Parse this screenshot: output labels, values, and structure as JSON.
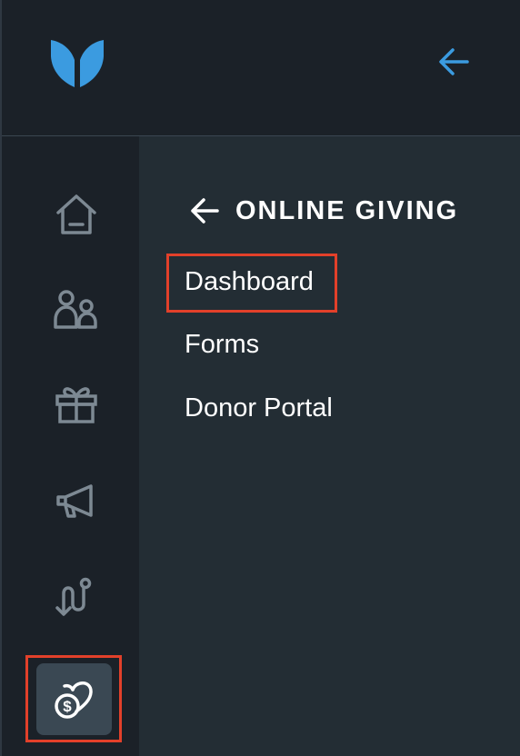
{
  "header": {
    "logo_icon": "shield-leaf-logo",
    "collapse_icon": "arrow-left-icon",
    "accent_color": "#3b9be0"
  },
  "rail": {
    "items": [
      {
        "icon": "home-icon"
      },
      {
        "icon": "people-icon"
      },
      {
        "icon": "gift-icon"
      },
      {
        "icon": "megaphone-icon"
      },
      {
        "icon": "route-icon"
      },
      {
        "icon": "donation-heart-icon",
        "active": true
      }
    ]
  },
  "panel": {
    "back_icon": "arrow-left-icon",
    "title": "ONLINE GIVING",
    "items": [
      {
        "label": "Dashboard",
        "highlighted": true
      },
      {
        "label": "Forms"
      },
      {
        "label": "Donor Portal"
      }
    ]
  },
  "highlight_color": "#e2402a"
}
